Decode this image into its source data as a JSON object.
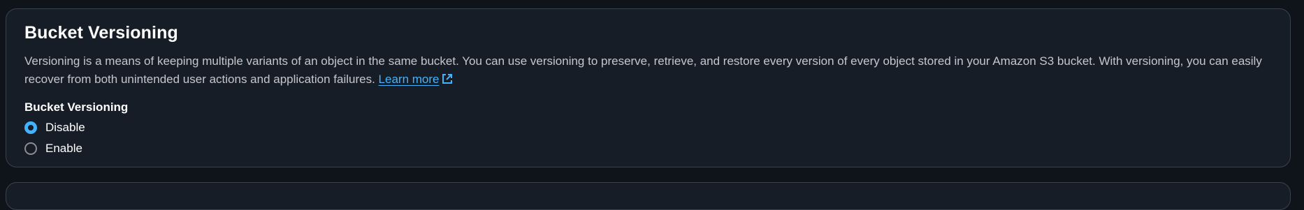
{
  "section": {
    "title": "Bucket Versioning",
    "description": "Versioning is a means of keeping multiple variants of an object in the same bucket. You can use versioning to preserve, retrieve, and restore every version of every object stored in your Amazon S3 bucket. With versioning, you can easily recover from both unintended user actions and application failures.",
    "learn_more": "Learn more",
    "link_icon": "external-link-icon"
  },
  "field": {
    "label": "Bucket Versioning",
    "options": [
      {
        "label": "Disable",
        "selected": true
      },
      {
        "label": "Enable",
        "selected": false
      }
    ]
  },
  "colors": {
    "accent": "#42b4ff",
    "panel": "#161d26",
    "border": "#3a434d"
  }
}
